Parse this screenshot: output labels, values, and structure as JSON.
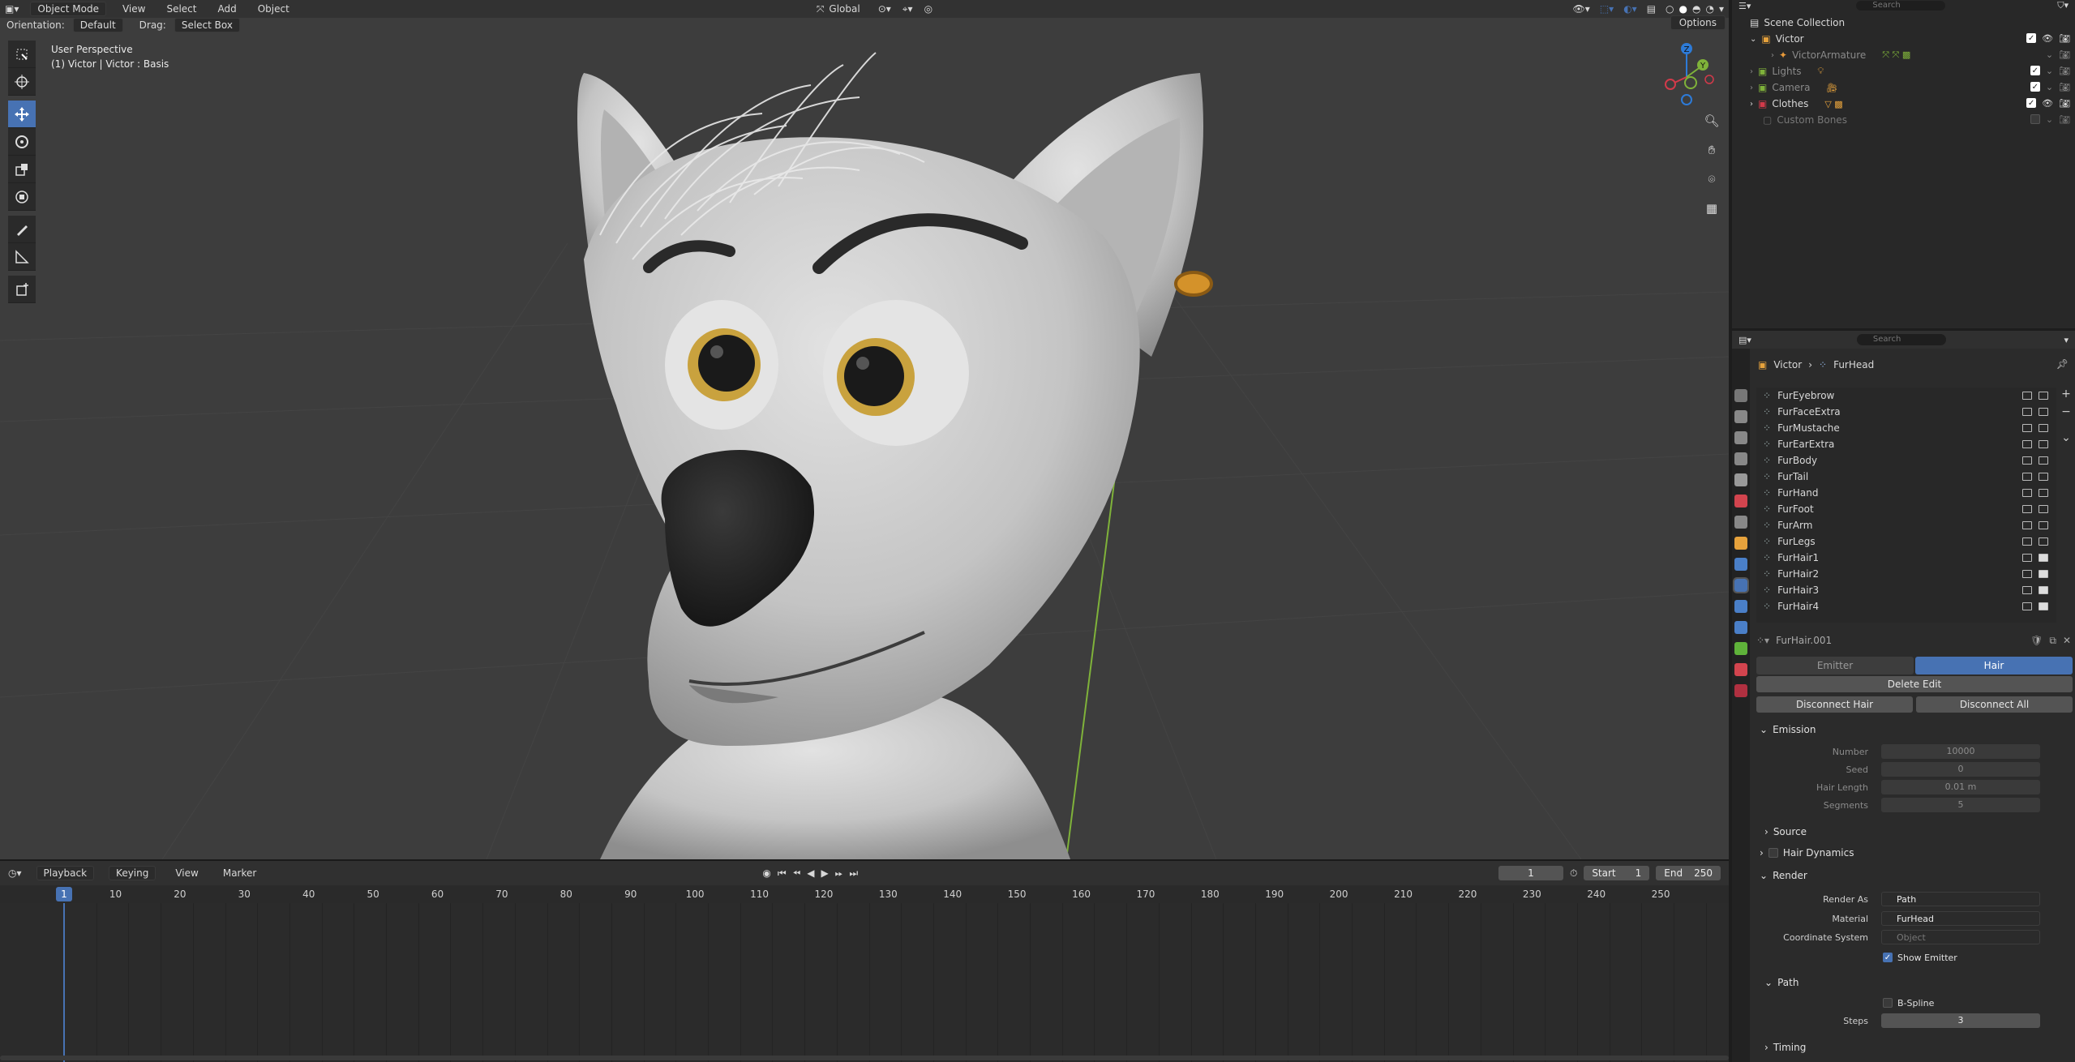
{
  "viewport": {
    "mode": "Object Mode",
    "menus": [
      "View",
      "Select",
      "Add",
      "Object"
    ],
    "transform_orientation": "Global",
    "orientation_label": "Orientation:",
    "orientation_value": "Default",
    "drag_label": "Drag:",
    "drag_value": "Select Box",
    "options_label": "Options",
    "info_line1": "User Perspective",
    "info_line2": "(1) Victor | Victor : Basis",
    "gizmo_axes": {
      "x": "X",
      "y": "Y",
      "z": "Z"
    }
  },
  "timeline": {
    "menus": [
      "Playback",
      "Keying",
      "View",
      "Marker"
    ],
    "current_frame": "1",
    "start_label": "Start",
    "start_value": "1",
    "end_label": "End",
    "end_value": "250",
    "ruler_ticks": [
      "10",
      "20",
      "30",
      "40",
      "50",
      "60",
      "70",
      "80",
      "90",
      "100",
      "110",
      "120",
      "130",
      "140",
      "150",
      "160",
      "170",
      "180",
      "190",
      "200",
      "210",
      "220",
      "230",
      "240",
      "250"
    ],
    "playhead_label": "1"
  },
  "outliner": {
    "search_placeholder": "Search",
    "items": [
      {
        "label": "Scene Collection",
        "indent": 0
      },
      {
        "label": "Victor",
        "indent": 1
      },
      {
        "label": "VictorArmature",
        "indent": 2
      },
      {
        "label": "Lights",
        "indent": 1
      },
      {
        "label": "Camera",
        "indent": 1
      },
      {
        "label": "Clothes",
        "indent": 1
      },
      {
        "label": "Custom Bones",
        "indent": 1
      }
    ]
  },
  "properties": {
    "search_placeholder": "Search",
    "breadcrumb": [
      "Victor",
      "FurHead"
    ],
    "particle_systems": [
      "FurEyebrow",
      "FurFaceExtra",
      "FurMustache",
      "FurEarExtra",
      "FurBody",
      "FurTail",
      "FurHand",
      "FurFoot",
      "FurArm",
      "FurLegs",
      "FurHair1",
      "FurHair2",
      "FurHair3",
      "FurHair4"
    ],
    "settings_name": "FurHair.001",
    "type_tabs": [
      "Emitter",
      "Hair"
    ],
    "delete_edit": "Delete Edit",
    "disconnect_hair": "Disconnect Hair",
    "disconnect_all": "Disconnect All",
    "emission": {
      "header": "Emission",
      "number_label": "Number",
      "number_value": "10000",
      "seed_label": "Seed",
      "seed_value": "0",
      "hair_length_label": "Hair Length",
      "hair_length_value": "0.01 m",
      "segments_label": "Segments",
      "segments_value": "5"
    },
    "source_header": "Source",
    "hair_dynamics_header": "Hair Dynamics",
    "render": {
      "header": "Render",
      "render_as_label": "Render As",
      "render_as_value": "Path",
      "material_label": "Material",
      "material_value": "FurHead",
      "coord_label": "Coordinate System",
      "coord_placeholder": "Object",
      "show_emitter": "Show Emitter"
    },
    "path": {
      "header": "Path",
      "bspline": "B-Spline",
      "steps_label": "Steps",
      "steps_value": "3"
    },
    "timing_header": "Timing"
  },
  "colors": {
    "accent": "#4772b3",
    "viewport_bg": "#3d3d3d",
    "eye_ring": "#c9a23e",
    "earring": "#d4922a",
    "axis_y_line": "#7fb23a"
  }
}
